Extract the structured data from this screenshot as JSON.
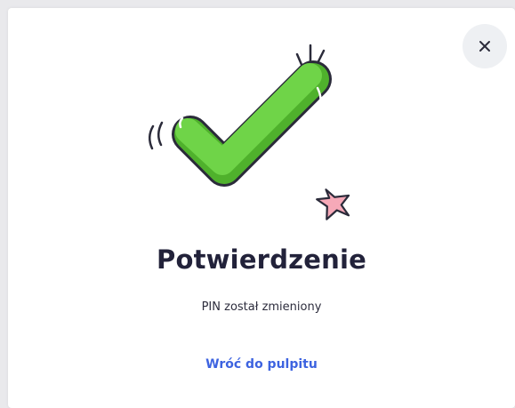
{
  "dialog": {
    "title": "Potwierdzenie",
    "message": "PIN został zmieniony",
    "back_link": "Wróć do pulpitu",
    "close_icon": "close-icon"
  },
  "colors": {
    "checkmark_fill": "#6fd448",
    "accent_link": "#3d63e0",
    "sparkle_fill": "#f6a9b8"
  }
}
